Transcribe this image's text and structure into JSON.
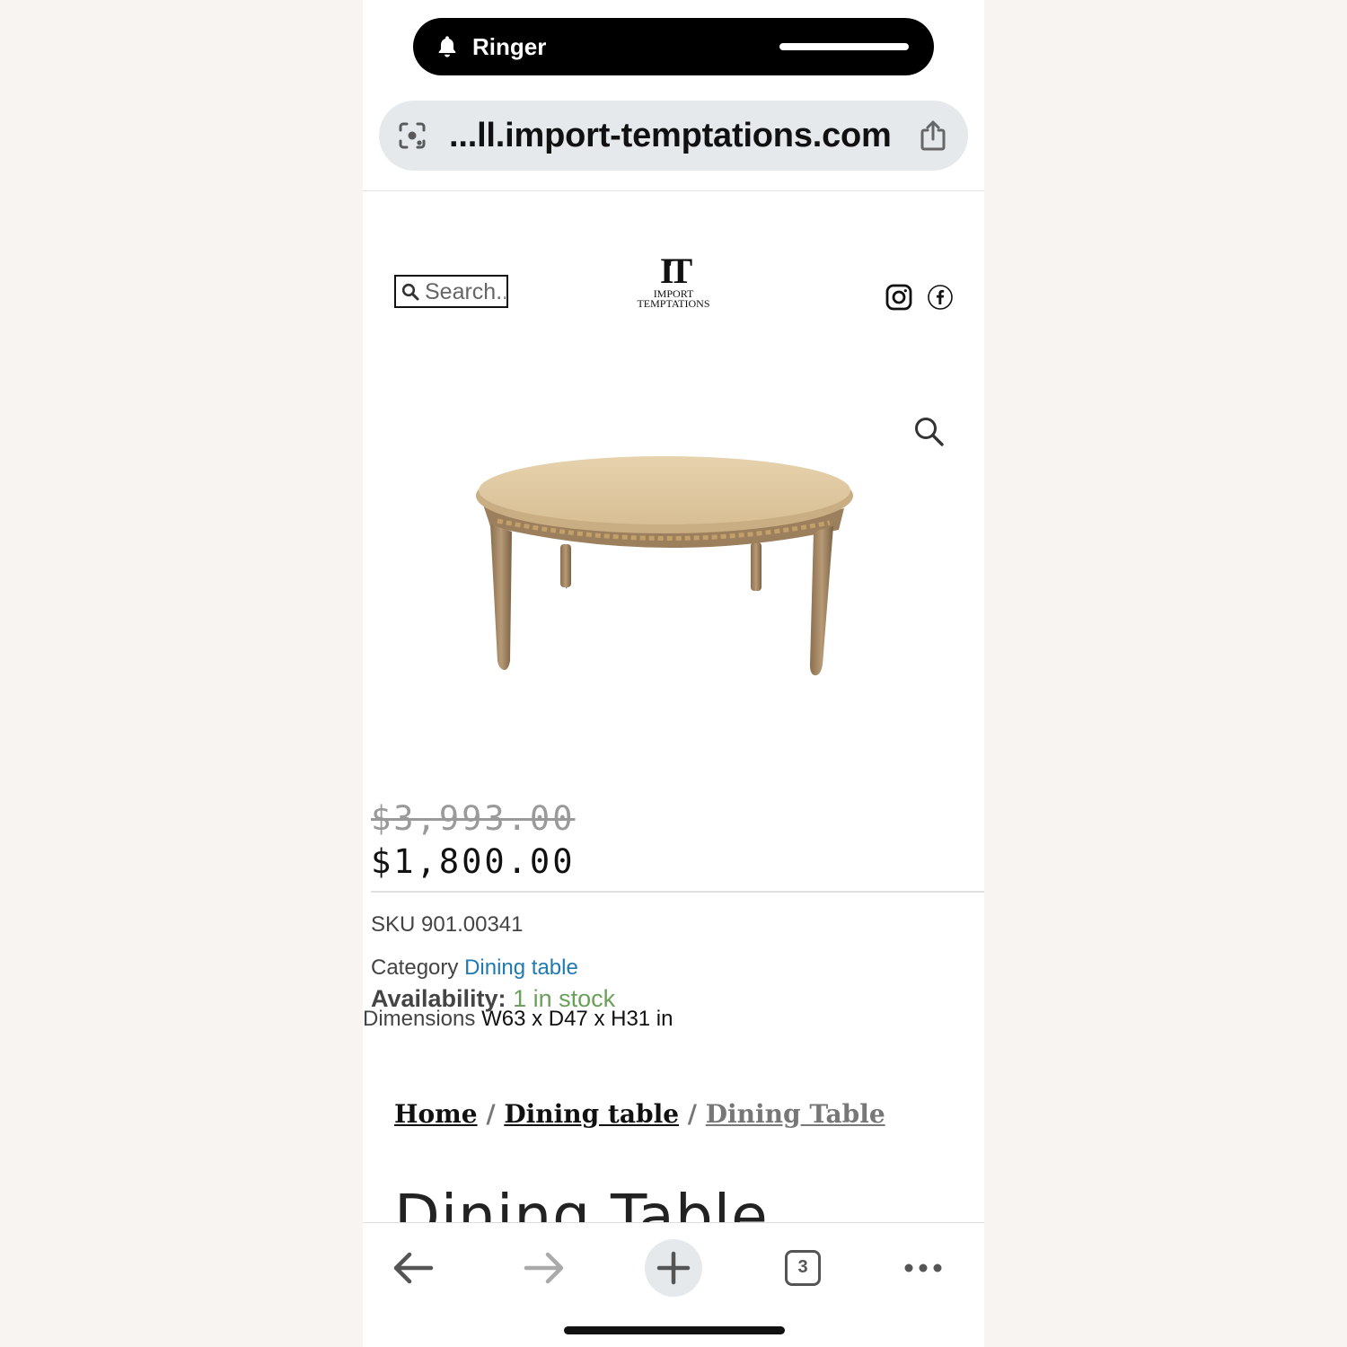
{
  "status": {
    "ringer_label": "Ringer"
  },
  "browser": {
    "url": "...ll.import-temptations.com",
    "tab_count": "3"
  },
  "header": {
    "search_placeholder": "Search...",
    "logo": {
      "monogram": "IT",
      "line1": "IMPORT",
      "line2": "TEMPTATIONS"
    },
    "social": [
      "instagram-icon",
      "facebook-icon"
    ]
  },
  "product": {
    "old_price": "$3,993.00",
    "price": "$1,800.00",
    "sku_label": "SKU",
    "sku": "901.00341",
    "category_label": "Category",
    "category": "Dining table",
    "availability_label": "Availability:",
    "availability": "1 in stock",
    "dimensions_label": "Dimensions",
    "dimensions": "W63 x D47 x H31 in",
    "title": "Dining Table"
  },
  "breadcrumb": {
    "home": "Home",
    "sep1": " / ",
    "category": "Dining table",
    "sep2": " / ",
    "current": "Dining Table"
  },
  "colors": {
    "link": "#1f7ab3",
    "in_stock": "#6aa05a",
    "page_bg": "#f7f4f1"
  }
}
